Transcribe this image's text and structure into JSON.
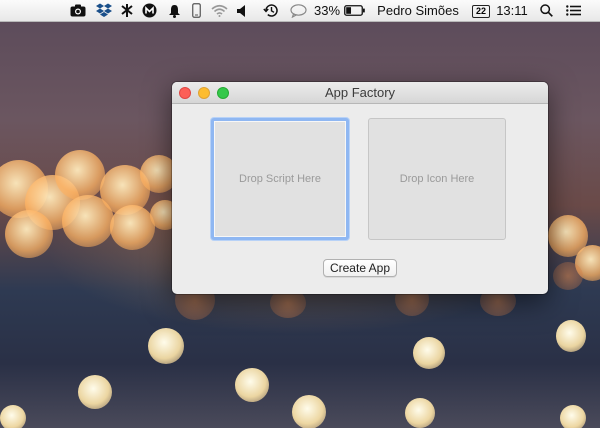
{
  "menubar": {
    "status_icons": [
      {
        "name": "camera-icon"
      },
      {
        "name": "dropbox-icon"
      },
      {
        "name": "network-tool-icon"
      },
      {
        "name": "m-badge-icon"
      },
      {
        "name": "notification-bell-icon"
      },
      {
        "name": "phone-icon"
      },
      {
        "name": "wifi-icon"
      },
      {
        "name": "volume-icon"
      },
      {
        "name": "time-machine-icon"
      },
      {
        "name": "messages-icon"
      }
    ],
    "battery_percent": "33%",
    "battery_level": 0.33,
    "user_name": "Pedro Simões",
    "calendar_day": "22",
    "clock": "13:11",
    "search_icon": "spotlight-search-icon",
    "list_icon": "notification-center-icon"
  },
  "window": {
    "title": "App Factory",
    "drop_script_label": "Drop Script Here",
    "drop_icon_label": "Drop Icon Here",
    "create_button_label": "Create App",
    "colors": {
      "close": "#fc5f57",
      "minimize": "#fdbc2e",
      "zoom": "#34c84a",
      "focus_ring": "#8fb7f2"
    }
  }
}
